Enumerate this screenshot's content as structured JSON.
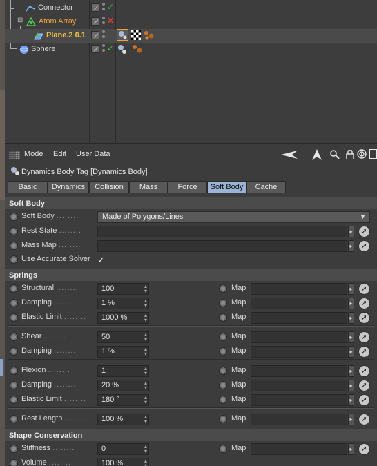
{
  "object_manager": {
    "objects": [
      {
        "name": "Connector",
        "color": "#d8d8d8",
        "status": "check"
      },
      {
        "name": "Atom Array",
        "color": "#e8a13a",
        "status": "cross"
      },
      {
        "name": "Plane.2 0.1",
        "color": "#f0c040",
        "status": ""
      },
      {
        "name": "Sphere",
        "color": "#d8d8d8",
        "status": "check"
      }
    ],
    "expander": "⊟"
  },
  "attribute_manager": {
    "menu": [
      "Mode",
      "Edit",
      "User Data"
    ],
    "title": "Dynamics Body Tag [Dynamics Body]",
    "tabs": [
      "Basic",
      "Dynamics",
      "Collision",
      "Mass",
      "Force",
      "Soft Body",
      "Cache"
    ],
    "active_tab": "Soft Body",
    "sections": {
      "soft_body": "Soft Body",
      "springs": "Springs",
      "shape_conservation": "Shape Conservation"
    },
    "soft_body": {
      "soft_body_label": "Soft Body",
      "soft_body_value": "Made of Polygons/Lines",
      "rest_state_label": "Rest State",
      "mass_map_label": "Mass Map",
      "use_accurate_solver_label": "Use Accurate Solver",
      "use_accurate_solver_value": "✓"
    },
    "springs": {
      "map_label": "Map",
      "rows": [
        {
          "label": "Structural",
          "value": "100"
        },
        {
          "label": "Damping",
          "value": "1 %"
        },
        {
          "label": "Elastic Limit",
          "value": "1000 %"
        },
        {
          "label": "Shear",
          "value": "50"
        },
        {
          "label": "Damping",
          "value": "1 %"
        },
        {
          "label": "Flexion",
          "value": "1"
        },
        {
          "label": "Damping",
          "value": "20 %"
        },
        {
          "label": "Elastic Limit",
          "value": "180 °"
        },
        {
          "label": "Rest Length",
          "value": "100 %"
        }
      ]
    },
    "shape_conservation": {
      "rows": [
        {
          "label": "Stiffness",
          "value": "0"
        },
        {
          "label": "Volume",
          "value": "100 %"
        }
      ]
    },
    "dot_leader": "........"
  }
}
